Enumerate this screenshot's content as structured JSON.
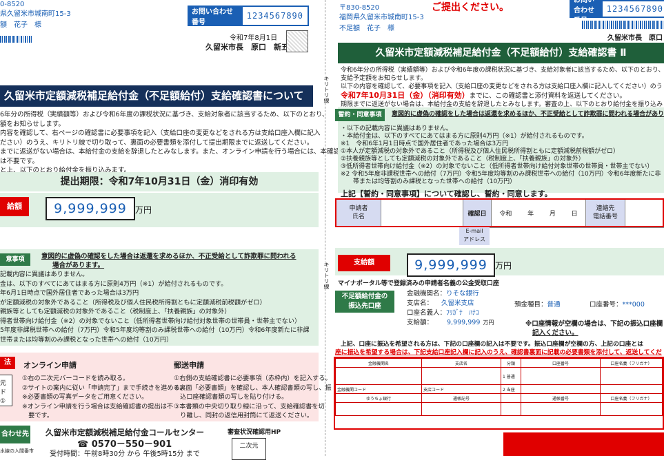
{
  "left": {
    "address_lines": [
      "0-8520",
      "県久留米市城南町15-3",
      "額　花子　様"
    ],
    "inquiry_label": "お問い合わせ番号",
    "inquiry_number": "1234567890",
    "date": "令和7年8月1日",
    "mayor": "久留米市長　原口　新五",
    "title": "久留米市定額減税補足給付金（不足額給付）支給確認書について",
    "intro_lines": [
      "6年分の所得税（実績額等）および令和6年度の課税状況に基づき、支給対象者に該当するため、以下のとおり、",
      "額をお知らせします。",
      "内容を確認して、右ページの確認書に必要事項を記入（支給口座の変更などをされる方は支給口座入欄に記入",
      "ださい）のうえ、キリトリ線で切り取って、裏面の必要書類を添付して提出期限までに返送してください。",
      "までに返送がない場合は、本給付金の支給を辞退したとみなします。また、オンライン申請を行う場合には、本確認書",
      "は不要です。",
      "と上、以下のとおり給付金を振り込みます。"
    ],
    "deadline": "提出期限：令和7年10月31日（金）消印有効",
    "amount_label": "給額",
    "amount": "9,999,999",
    "yen": "万円",
    "consent_label": "意事項",
    "consent_warning": "意図的に虚偽の確認をした場合は返還を求めるほか、不正受給として詐欺罪に問われる",
    "consent_warning2": "場合があります。",
    "consent_lines": [
      "記載内容に異議はありません。",
      "金は、以下のすべてにあてはまる方に原則4万円（※1）が給付されるものです。",
      "年6月1日時点で国外居住者であった場合は3万円",
      "が定額減税の対象外であること（所得税及び個人住民税所得割ともに定額減税前税額がゼロ）",
      "親族等としても定額減税の対象外であること（税制度上、「扶養親族」の対象外）",
      "得者世帯向け給付金（※2）の対象でないこと（低所得者世帯向け給付対象世帯の世帯員・世帯主でない）",
      "5年度非課税世帯への給付（7万円）令和5年度均等割のみ課税世帯への給付（10万円）令和6年度新たに非課",
      "世帯または均等割のみ課税となった世帯への給付（10万円）"
    ],
    "method_label": "法",
    "online_title": "オンライン申請",
    "online_lines": [
      "①右の二次元バーコードを読み取る。",
      "②サイトの案内に従い「申請完了」まで手続きを進める。",
      "※必要書類の写真データをご用意ください。",
      "※オンライン申請を行う場合は支給確認書の提出は不",
      "　要です。"
    ],
    "qr_text": [
      "元",
      "ド①"
    ],
    "mail_title": "郵送申請",
    "mail_lines": [
      "①右側の支給確認書に必要事項（赤枠内）を記入する。",
      "②裏面「必要書類」を確認し、本人確認書類の写し、振",
      "　込口座確認書類の写しを貼り付ける。",
      "③本書類の中央切り取り線に沿って、支給確認書を切",
      "　り離し、同封の返信用封筒にて返送ください。"
    ],
    "contact_label": "合わせ先",
    "contact_sub": "水線の入間番市",
    "callcenter": "久留米市定額減税補足給付金コールセンター",
    "phone": "☎ 0570－550－901",
    "hours": "受付時間：午前8時30分 から 午後5時15分 まで",
    "hp_label": "審査状況確認用HP",
    "hp_qr": "二次元"
  },
  "cut_line": "キリトリ線",
  "right": {
    "postal": "〒830-8520",
    "address": "福岡県久留米市城南町15-3",
    "name": "不足額　花子　様",
    "red_top": "ご提出ください。",
    "inquiry_label": "お問い合わせ番号",
    "inquiry_number": "1234567890",
    "mayor": "久留米市長　原口",
    "title": "久留米市定額減税補足給付金（不足額給付）支給確認書 Ⅱ",
    "intro_lines": [
      "令和6年分の所得税（実績額等）および令和6年度の課税状況に基づき、支給対象者に該当するため、以下のとおり、",
      "支給予定額をお知らせします。",
      "以下の内容を確認して、必要事項を記入（支給口座の変更などをされる方は支給口座入欄に記入してください）のう"
    ],
    "deadline_red": "令和7年10月31日（金）（消印有効）",
    "deadline_rest": "までに、この確認書と添付資料を返送してください。",
    "intro_line4": "期限までに返送がない場合は、本給付金の支給を辞退したとみなします。審査の上、以下のとおり給付金を振り込み",
    "consent_label": "誓約・同意事項",
    "consent_warning": "意図的に虚偽の確認をした場合は返還を求めるほか、不正受給として詐欺罪に問われる場合があり",
    "consent_lines": [
      "・以下の記載内容に異議はありません。",
      "・本給付金は、以下のすべてにあてはまる方に原則4万円（※1）が給付されるものです。",
      "※1　令和6年1月1日時点で国外居住者であった場合は3万円",
      "①本人が定額減税の対象外であること（所得税及び個人住民税所得割ともに定額減税前税額がゼロ）",
      "②扶養親族等としても定額減税の対象外であること（税制度上、「扶養親族」の対象外）",
      "③低所得者世帯向け給付金（※2）の対象でないこと（低所得者世帯向け給付対象世帯の世帯員・世帯主でない）",
      "※2 令和5年度非課税世帯への給付（7万円）令和5年度均等割のみ課税世帯への給付（10万円）令和6年度新たに非",
      "　　帯または均等割のみ課税となった世帯への給付（10万円）"
    ],
    "confirm_heading": "上記【誓約・同意事項】について確認し、誓約・同意します。",
    "applicant_label": "申請者\n氏名",
    "confirm_date_label": "確認日",
    "date_parts": [
      "令和",
      "年",
      "月",
      "日"
    ],
    "contact_label": "連絡先\n電話番号",
    "email_label": "E-mail\nアドレス",
    "amount_label": "支給額",
    "amount": "9,999,999",
    "yen": "万円",
    "myna_note": "マイナポータル等で登録済みの申請者名義の公金受取口座",
    "account_label": "不足額給付金の\n振込先口座",
    "bank_name_label": "金融機関名：",
    "bank_name": "りそな銀行",
    "branch_label": "支店名：",
    "branch": "久留米支店",
    "deposit_type_label": "預金種目：",
    "deposit_type": "普通",
    "account_no_label": "口座番号：",
    "account_no": "***000",
    "holder_label": "口座名義人：",
    "holder": "ﾌﾘｶﾞﾅ　ﾊﾅｺ",
    "pay_label": "支給額：",
    "pay": "9,999,999",
    "pay_yen": "万円",
    "blank_note": "※口座情報が空欄の場合は、下記の振込口座欄",
    "blank_note2": "記入ください。",
    "transfer_note": "上記、口座に振込を希望される方は、下記の口座欄の記入は不要です。振込口座欄が空欄の方、上記の口座とは",
    "transfer_note2": "座に振込を希望する場合は、下記支給口座記入欄に記入のうえ、確認書裏面に記載の必要書類を添付して、返送してくだ",
    "bank_table": {
      "r1": [
        "金融機関名",
        "支店名",
        "分類",
        "口座番号",
        "口座名義（フリガナ）"
      ],
      "r2": [
        "金融機関コード",
        "支店コード",
        "1 普通",
        "2 当座"
      ],
      "r3": [
        "ゆうちょ銀行",
        "通帳記号",
        "通帳番号",
        "口座名義（フリガナ）"
      ]
    }
  },
  "colors": {
    "navy": "#15305a",
    "green": "#1f5f3a",
    "red": "#e00000",
    "blue": "#1a5fb4"
  }
}
